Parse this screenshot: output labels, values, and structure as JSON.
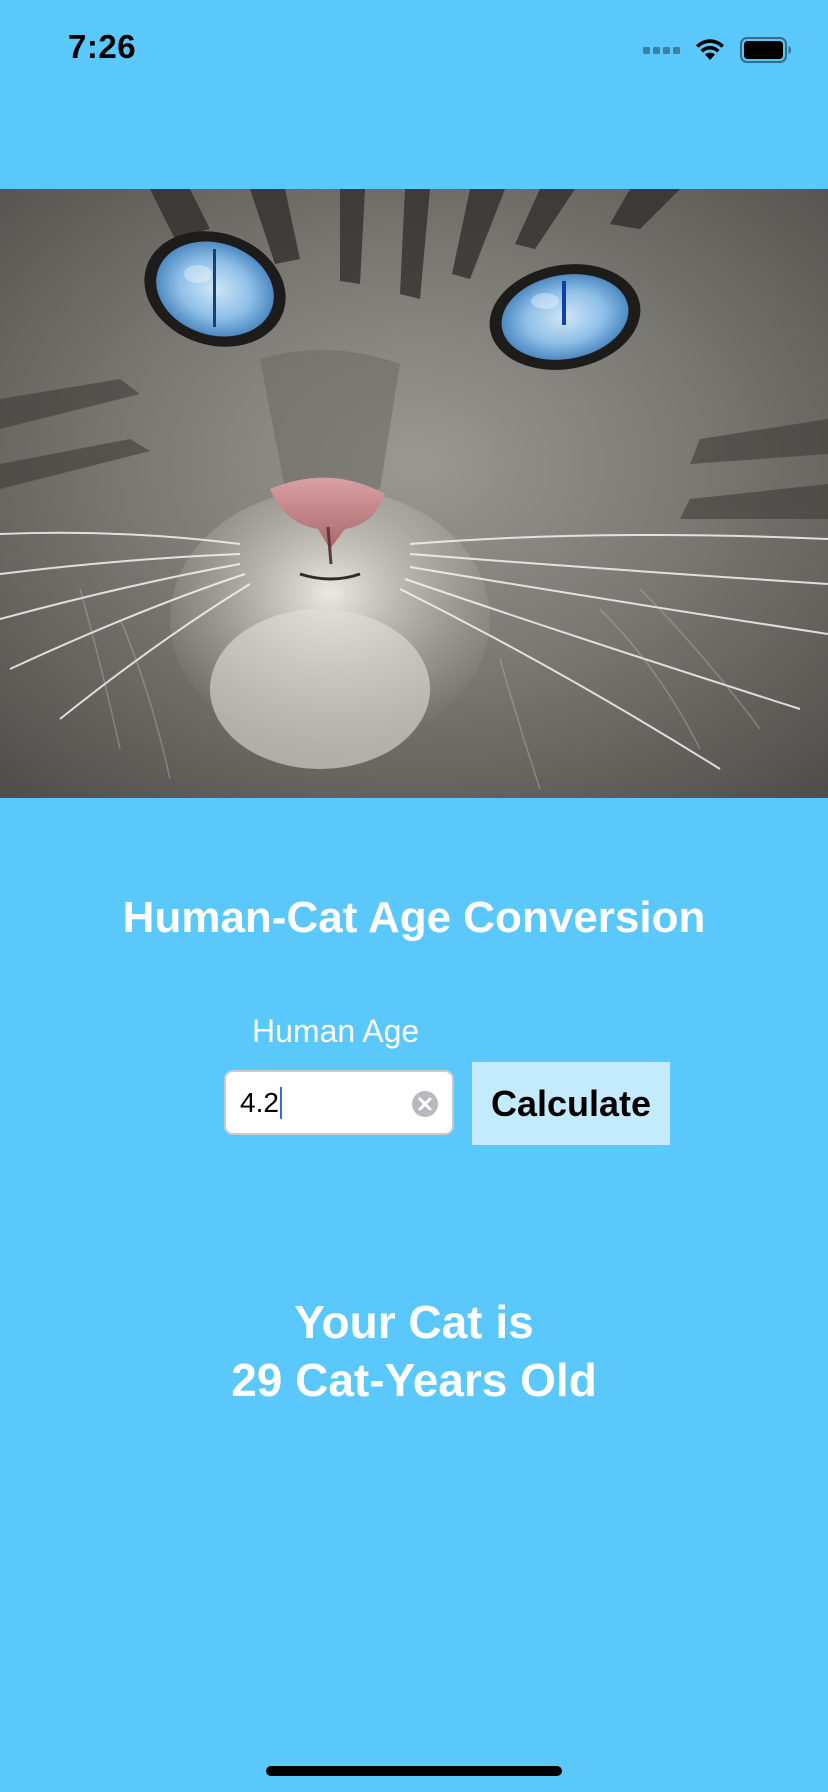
{
  "status_bar": {
    "time": "7:26",
    "icons": [
      "cellular-signal-icon",
      "wifi-icon",
      "battery-icon"
    ]
  },
  "hero_image": {
    "subject": "cat-photo"
  },
  "title": "Human-Cat Age Conversion",
  "age_input": {
    "label": "Human Age",
    "value": "4.2",
    "clear_icon": "clear-circle-icon"
  },
  "calculate_button": {
    "label": "Calculate"
  },
  "result": {
    "line1": "Your Cat is",
    "line2": "29 Cat-Years Old"
  },
  "colors": {
    "background": "#5ac8fa",
    "button_background": "#c3ebfd",
    "text": "#ffffff"
  }
}
